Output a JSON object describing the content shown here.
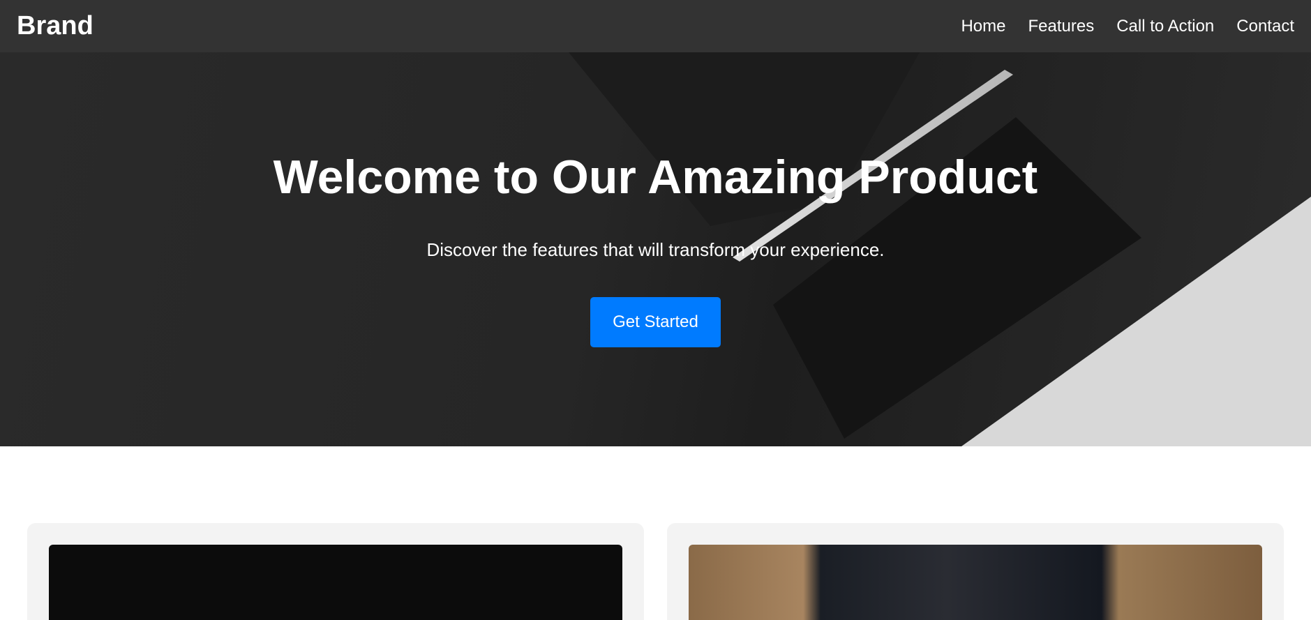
{
  "nav": {
    "brand": "Brand",
    "links": [
      "Home",
      "Features",
      "Call to Action",
      "Contact"
    ]
  },
  "hero": {
    "title": "Welcome to Our Amazing Product",
    "subtitle": "Discover the features that will transform your experience.",
    "cta": "Get Started",
    "cta_color": "#007bff"
  }
}
